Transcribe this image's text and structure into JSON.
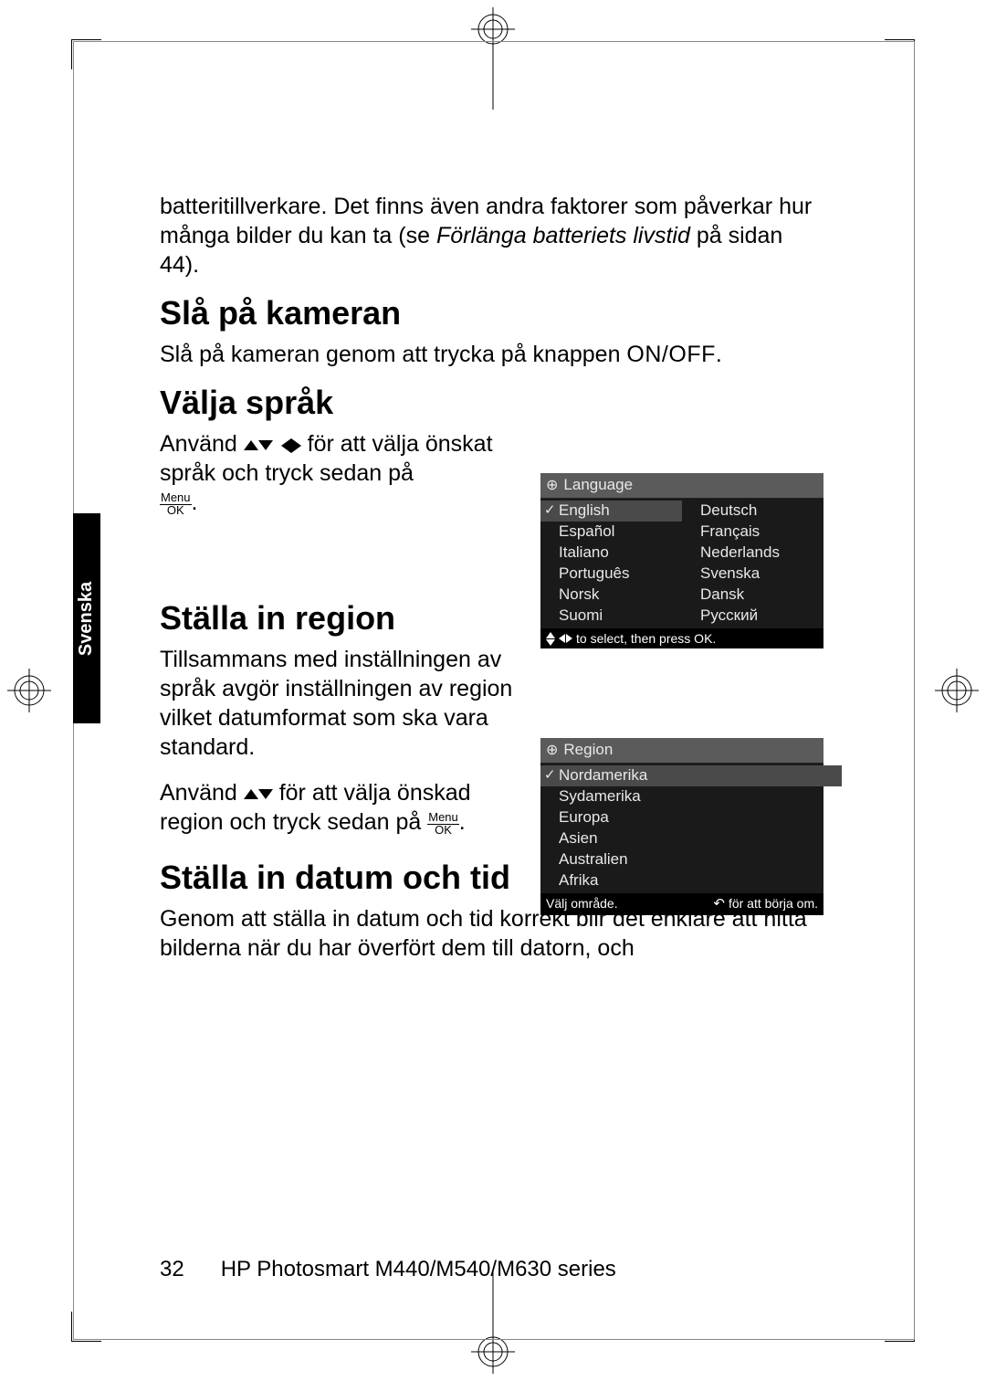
{
  "intro_para": {
    "line1": "batteritillverkare. Det finns även andra faktorer som påverkar hur många bilder du kan ta (se ",
    "italic": "Förlänga batteriets livstid",
    "line2": " på sidan 44)."
  },
  "h_power": "Slå på kameran",
  "power_para_a": "Slå på kameran genom att trycka på knappen ",
  "power_para_b": "ON/OFF",
  "power_para_c": ".",
  "h_lang": "Välja språk",
  "lang_para_a": "Använd ",
  "lang_para_b": " för att välja önskat språk och tryck sedan på ",
  "lang_para_c": ".",
  "h_region": "Ställa in region",
  "region_para1": "Tillsammans med inställningen av språk avgör inställningen av region vilket datumformat som ska vara standard.",
  "region_para2_a": "Använd ",
  "region_para2_b": " för att välja önskad region och tryck sedan på ",
  "region_para2_c": ".",
  "h_datetime": "Ställa in datum och tid",
  "datetime_para": "Genom att ställa in datum och tid korrekt blir det enklare att hitta bilderna när du har överfört dem till datorn, och",
  "side_tab": "Svenska",
  "lang_screen": {
    "title": "Language",
    "rows": [
      [
        "English",
        "Deutsch"
      ],
      [
        "Español",
        "Français"
      ],
      [
        "Italiano",
        "Nederlands"
      ],
      [
        "Português",
        "Svenska"
      ],
      [
        "Norsk",
        "Dansk"
      ],
      [
        "Suomi",
        "Русский"
      ]
    ],
    "footer": "to select, then press OK."
  },
  "region_screen": {
    "title": "Region",
    "items": [
      "Nordamerika",
      "Sydamerika",
      "Europa",
      "Asien",
      "Australien",
      "Afrika"
    ],
    "footer_a": "Välj område.",
    "footer_b": "för att börja om."
  },
  "page_num": "32",
  "series": "HP Photosmart M440/M540/M630 series",
  "menu_label": "Menu",
  "ok_label": "OK"
}
